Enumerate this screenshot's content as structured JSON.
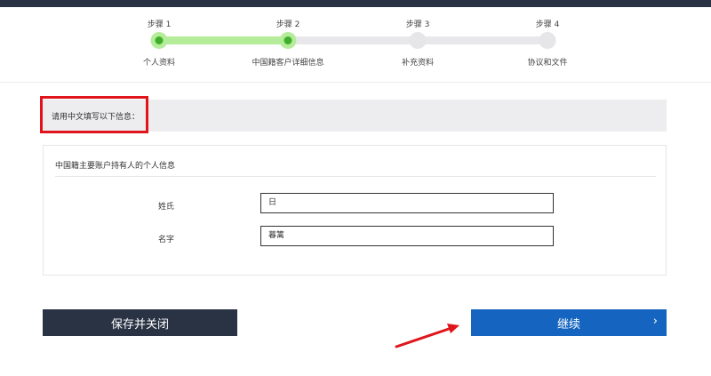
{
  "steps": [
    {
      "top_label": "步骤 1",
      "bottom_label": "个人资料",
      "done": true
    },
    {
      "top_label": "步骤 2",
      "bottom_label": "中国籍客户详细信息",
      "done": true
    },
    {
      "top_label": "步骤 3",
      "bottom_label": "补充资料",
      "done": false
    },
    {
      "top_label": "步骤 4",
      "bottom_label": "协议和文件",
      "done": false
    }
  ],
  "notice": {
    "text": "请用中文填写以下信息："
  },
  "card": {
    "title": "中国籍主要账户持有人的个人信息",
    "surname_label": "姓氏",
    "surname_value": "日",
    "given_name_label": "名字",
    "given_name_value": "暮篱"
  },
  "buttons": {
    "save_label": "保存并关闭",
    "continue_label": "继续",
    "continue_chevron": "›"
  },
  "colors": {
    "header_dark": "#2a3344",
    "step_done": "#b5ec9a",
    "step_dot": "#3fae2a",
    "primary": "#1565c0",
    "highlight": "#e0151b"
  }
}
